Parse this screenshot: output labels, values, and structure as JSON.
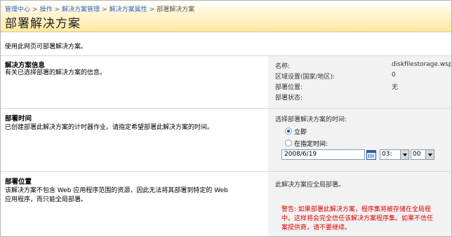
{
  "breadcrumb": {
    "items": [
      "管理中心",
      "操作",
      "解决方案管理",
      "解决方案属性"
    ],
    "separator": ">",
    "current": "部署解决方案"
  },
  "page": {
    "title": "部署解决方案",
    "intro": "使用此网页可部署解决方案。"
  },
  "solution_info": {
    "title": "解决方案信息",
    "desc": "有关已选择部署的解决方案的信息。",
    "rows": [
      {
        "label": "名称:",
        "value": "diskfilestorage.wsp"
      },
      {
        "label": "区域设置(国家/地区):",
        "value": "0"
      },
      {
        "label": "部署位置:",
        "value": "无"
      },
      {
        "label": "部署状态:",
        "value": ""
      }
    ]
  },
  "deploy_time": {
    "title": "部署时间",
    "desc": "已创建部署此解决方案的计时器作业。请指定希望部署此解决方案的时间。",
    "prompt": "选择部署解决方案的时间:",
    "option_now": "立即",
    "option_at": "在指定时间:",
    "selected": "now",
    "date": "2008/6/19",
    "hour": "03:",
    "minute": "00"
  },
  "deploy_location": {
    "title": "部署位置",
    "desc_line1": "该解决方案不包含 Web 应用程序范围的资源，因此无法将其部署到特定的 Web",
    "desc_line2": "应用程序，而只能全局部署。",
    "info": "此解决方案应全局部署。",
    "warning_line1": "警告: 如果部署此解决方案，程序集将被存储在全局程",
    "warning_line2": "中。这样将会完全信任该解决方案程序集。如果不信任",
    "warning_line3": "案提供商，请不要继续。"
  }
}
